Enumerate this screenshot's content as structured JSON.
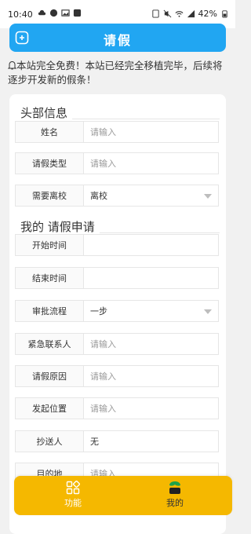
{
  "statusbar": {
    "time": "10:40",
    "battery": "42%"
  },
  "header": {
    "title": "请假"
  },
  "notice": {
    "text": "本站完全免费！本站已经完全移植完毕，后续将逐步开发新的假条！"
  },
  "sections": {
    "head": "头部信息",
    "apply": "我的 请假申请"
  },
  "form": {
    "name": {
      "label": "姓名",
      "placeholder": "请输入"
    },
    "leave_type": {
      "label": "请假类型",
      "placeholder": "请输入"
    },
    "leave_school": {
      "label": "需要离校",
      "value": "离校"
    },
    "start_time": {
      "label": "开始时间",
      "value": ""
    },
    "end_time": {
      "label": "结束时间",
      "value": ""
    },
    "approval": {
      "label": "审批流程",
      "value": "一步"
    },
    "emergency_contact": {
      "label": "紧急联系人",
      "placeholder": "请输入"
    },
    "reason": {
      "label": "请假原因",
      "placeholder": "请输入"
    },
    "location": {
      "label": "发起位置",
      "placeholder": "请输入"
    },
    "cc": {
      "label": "抄送人",
      "value": "无"
    },
    "destination": {
      "label": "目的地",
      "placeholder": "请输入"
    }
  },
  "bottomnav": {
    "functions": "功能",
    "mine": "我的"
  }
}
